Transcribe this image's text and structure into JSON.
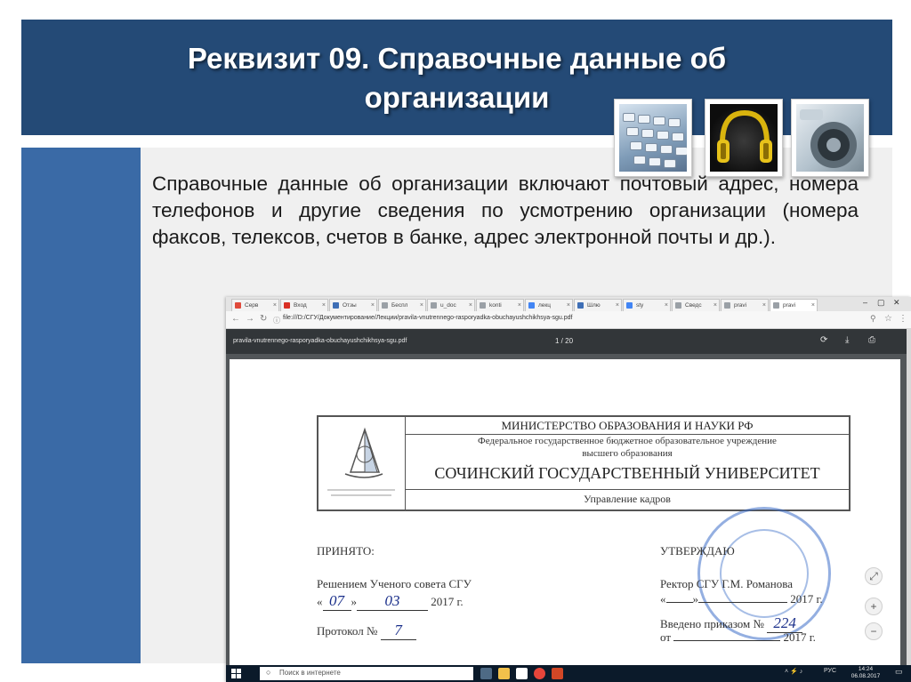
{
  "slide": {
    "title_line1": "Реквизит 09. Справочные данные об",
    "title_line2": "организации",
    "body_text": "Справочные данные об организации включают почтовый адрес, номера телефонов и другие сведения по усмотрению организации (номера факсов, телексов, счетов в банке, адрес электронной почты и др.).",
    "colors": {
      "title_band": "#244a76",
      "left_bar": "#3a6aa6",
      "panel": "#f0f0f0"
    },
    "thumbnails": [
      "keyboard-image",
      "headphones-image",
      "speaker-image"
    ]
  },
  "browser": {
    "tabs": [
      {
        "label": "Серв",
        "icon": "red-icon"
      },
      {
        "label": "Вход",
        "icon": "gmail-icon"
      },
      {
        "label": "Отзы",
        "icon": "blue-icon"
      },
      {
        "label": "Беспл",
        "icon": "doc-icon"
      },
      {
        "label": "u_doc",
        "icon": "doc-icon"
      },
      {
        "label": "konti",
        "icon": "doc-icon"
      },
      {
        "label": "лекц",
        "icon": "google-icon"
      },
      {
        "label": "Шлю",
        "icon": "blue-icon"
      },
      {
        "label": "sty",
        "icon": "google-icon"
      },
      {
        "label": "Сведс",
        "icon": "doc-icon"
      },
      {
        "label": "pravi",
        "icon": "doc-icon"
      },
      {
        "label": "pravi",
        "icon": "doc-icon",
        "active": true
      }
    ],
    "url": "file:///D:/СГУ/Документирование/Лекции/pravila-vnutrennego-rasporyadka-obuchayushchikhsya-sgu.pdf",
    "pdf_filename": "pravila-vnutrennego-rasporyadka-obuchayushchikhsya-sgu.pdf",
    "page_indicator": "1 / 20"
  },
  "document": {
    "ministry": "МИНИСТЕРСТВО ОБРАЗОВАНИЯ И НАУКИ РФ",
    "federal_line1": "Федеральное государственное бюджетное образовательное учреждение",
    "federal_line2": "высшего образования",
    "university": "СОЧИНСКИЙ ГОСУДАРСТВЕННЫЙ УНИВЕРСИТЕТ",
    "department": "Управление кадров",
    "left": {
      "accepted": "ПРИНЯТО:",
      "decision": "Решением Ученого совета СГУ",
      "date_day": "07",
      "date_month": "03",
      "date_year": "2017 г.",
      "protocol_label": "Протокол №",
      "protocol_number": "7"
    },
    "right": {
      "approved": "УТВЕРЖДАЮ",
      "rector": "Ректор СГУ   Г.М. Романова",
      "date_year": "2017 г.",
      "order_label": "Введено приказом №",
      "order_number": "224",
      "from_label": "от",
      "from_year": "2017 г."
    },
    "stamp_color": "#3c6ec8",
    "logo_caption": "СОЧИНСКИЙ ГОСУДАРСТВЕННЫЙ УНИВЕРСИТЕТ"
  },
  "taskbar": {
    "search_placeholder": "Поиск в интернете",
    "language": "РУС",
    "time": "14:24",
    "date": "06.08.2017"
  }
}
